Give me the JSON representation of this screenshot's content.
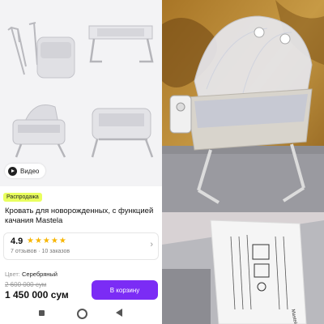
{
  "gallery": {
    "video_label": "Видео"
  },
  "product": {
    "badge": "Распродажа",
    "title": "Кровать для новорожденных, с функцией качания Mastela",
    "rating": "4.9",
    "stars": "★★★★★",
    "reviews": "7 отзывов · 10 заказов",
    "color_label": "Цвет:",
    "color_value": "Серебряный",
    "old_price": "2 600 000 сум",
    "price": "1 450 000 сум",
    "cart_button": "В корзину"
  },
  "photo2": {
    "label_text": "Mastela"
  },
  "colors": {
    "accent": "#7b2cf5",
    "badge": "#e9ff5e",
    "star": "#f7b500"
  }
}
